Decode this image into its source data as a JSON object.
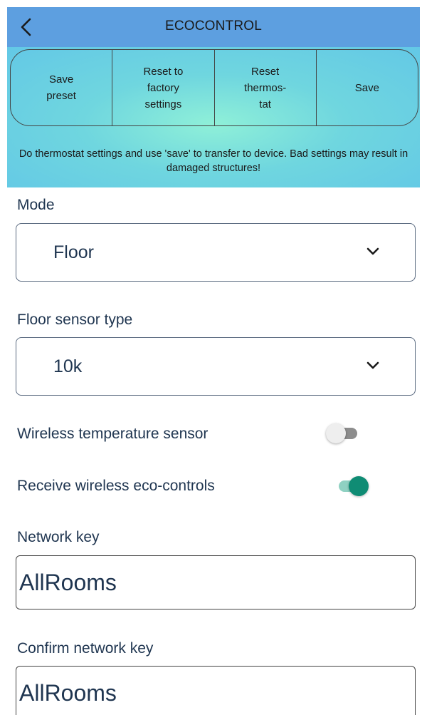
{
  "header": {
    "title": "ECOCONTROL",
    "back_icon": "chevron-left-icon"
  },
  "actions": {
    "save_preset": "Save\npreset",
    "reset_factory": "Reset to\nfactory\nsettings",
    "reset_thermostat": "Reset\nthermos-\ntat",
    "save": "Save"
  },
  "warning": "Do thermostat settings and use 'save' to transfer to device. Bad settings may result in damaged structures!",
  "mode": {
    "label": "Mode",
    "value": "Floor"
  },
  "floor_sensor": {
    "label": "Floor sensor type",
    "value": "10k"
  },
  "wireless_sensor": {
    "label": "Wireless temperature sensor",
    "enabled": false
  },
  "wireless_eco": {
    "label": "Receive wireless eco-controls",
    "enabled": true
  },
  "network_key": {
    "label": "Network key",
    "value": "AllRooms"
  },
  "confirm_network_key": {
    "label": "Confirm network key",
    "value": "AllRooms"
  },
  "colors": {
    "header": "#5d9fe0",
    "accent_teal": "#0f8c74",
    "text": "#1f3550"
  }
}
